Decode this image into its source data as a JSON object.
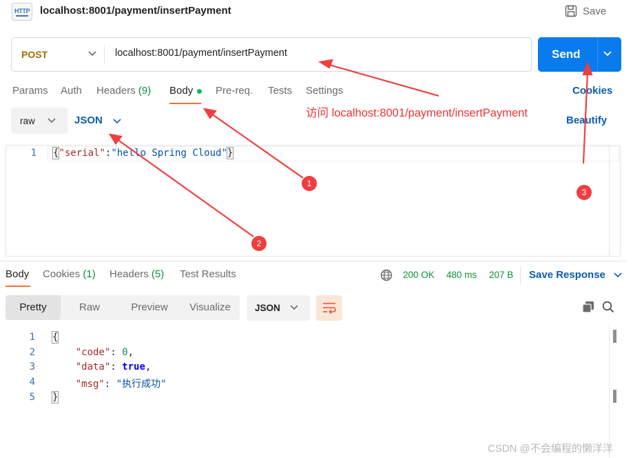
{
  "header": {
    "icon_text": "HTTP",
    "title": "localhost:8001/payment/insertPayment",
    "save_label": "Save"
  },
  "request": {
    "method": "POST",
    "url": "localhost:8001/payment/insertPayment",
    "send_label": "Send"
  },
  "request_tabs": {
    "params": "Params",
    "auth": "Auth",
    "headers": "Headers",
    "headers_count": "(9)",
    "body": "Body",
    "prereq": "Pre-req.",
    "tests": "Tests",
    "settings": "Settings",
    "cookies": "Cookies"
  },
  "body_mode": {
    "mode": "raw",
    "format": "JSON",
    "beautify": "Beautify"
  },
  "request_body": {
    "line_numbers": [
      "1"
    ],
    "open_brace": "{",
    "key": "\"serial\"",
    "colon": ":",
    "value": "\"hello Spring Cloud\"",
    "close_brace": "}"
  },
  "annotation": {
    "note": "访问 localhost:8001/payment/insertPayment",
    "badges": [
      "1",
      "2",
      "3"
    ],
    "color": "#ef3e42"
  },
  "response_tabs": {
    "body": "Body",
    "cookies": "Cookies",
    "cookies_count": "(1)",
    "headers": "Headers",
    "headers_count": "(5)",
    "test_results": "Test Results"
  },
  "response_status": {
    "status": "200 OK",
    "time": "480 ms",
    "size": "207 B",
    "save_response": "Save Response"
  },
  "response_view": {
    "modes": [
      "Pretty",
      "Raw",
      "Preview",
      "Visualize"
    ],
    "active_mode": "Pretty",
    "format": "JSON"
  },
  "response_body": {
    "line_numbers": [
      "1",
      "2",
      "3",
      "4",
      "5"
    ],
    "open_brace": "{",
    "code_key": "\"code\"",
    "code_value": "0",
    "data_key": "\"data\"",
    "data_value": "true",
    "msg_key": "\"msg\"",
    "msg_value": "\"执行成功\"",
    "close_brace": "}"
  },
  "watermark": "CSDN @不会编程的懒洋洋",
  "colors": {
    "accent_blue": "#097bed",
    "link_blue": "#0b5cad",
    "method_post": "#a46a00",
    "status_green": "#0c8f3a",
    "tab_underline": "#ff6c37"
  },
  "icons": {
    "save": "save-icon",
    "globe": "globe-icon",
    "copy": "copy-icon",
    "search": "search-icon",
    "wrap": "wrap-lines-icon"
  }
}
